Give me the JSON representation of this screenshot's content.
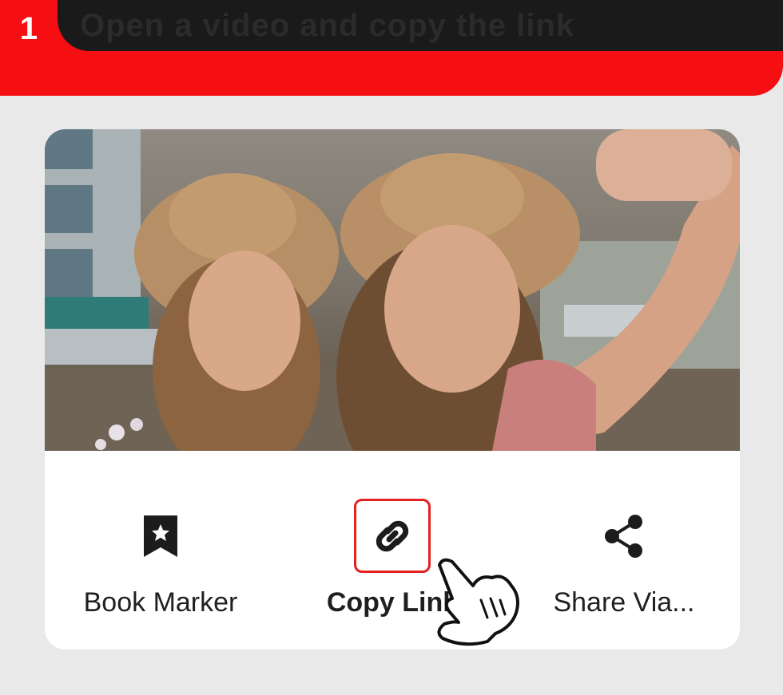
{
  "header": {
    "step": "1",
    "title": "Open a video and copy the link",
    "colors": {
      "accent": "#f50f12",
      "bar": "#1a1a1a"
    }
  },
  "card": {
    "image_description_icon": "photo",
    "actions": [
      {
        "label": "Book Marker",
        "icon": "bookmark-star-icon"
      },
      {
        "label": "Copy Link",
        "icon": "link-icon",
        "highlighted": true
      },
      {
        "label": "Share Via...",
        "icon": "share-icon"
      }
    ],
    "highlight_color": "#e42020"
  },
  "cursor": {
    "icon": "pointing-hand-icon"
  }
}
